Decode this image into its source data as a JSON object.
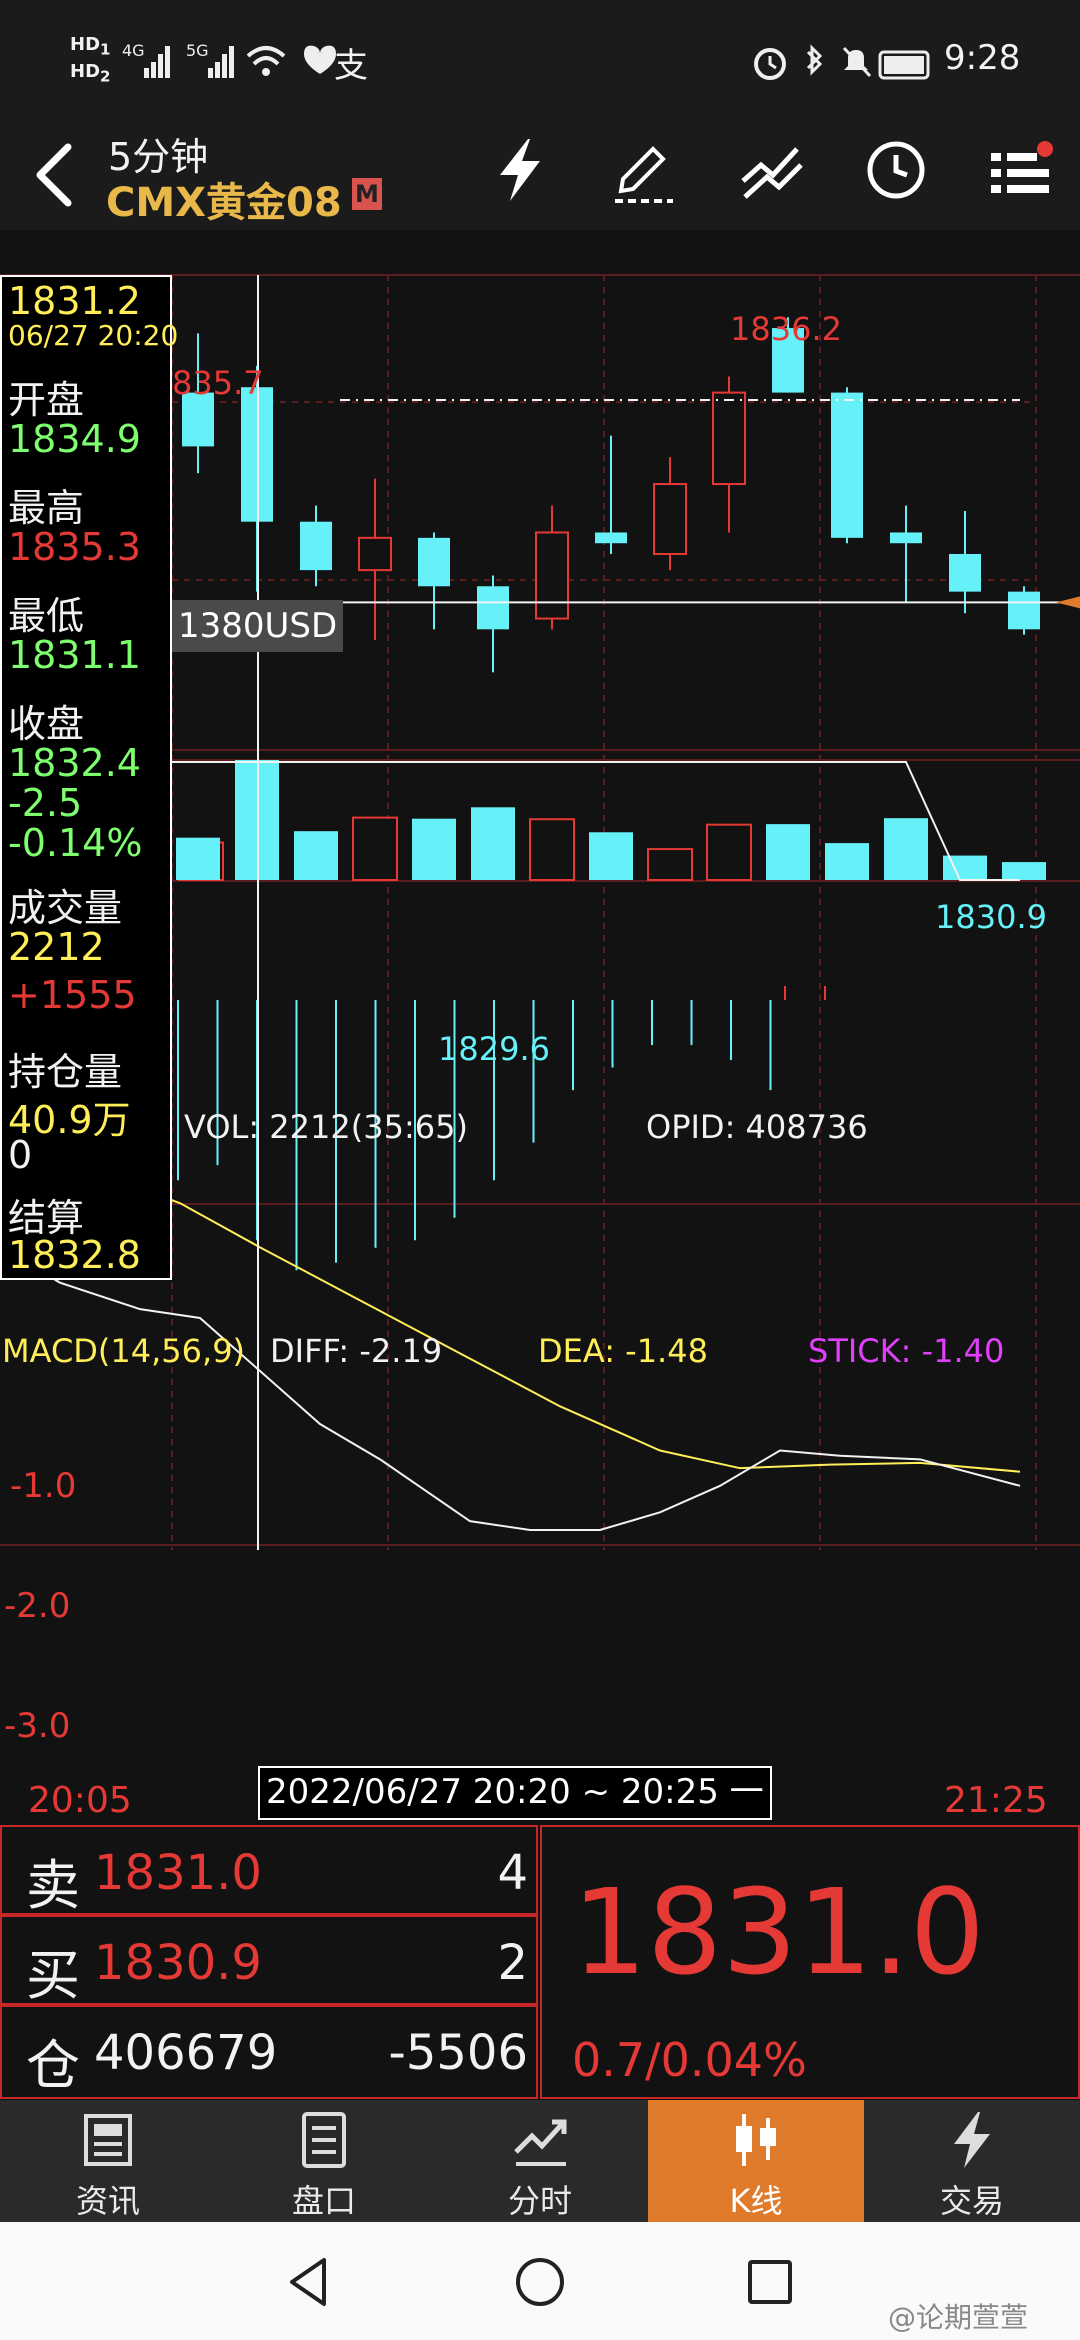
{
  "status_bar": {
    "left_text": "HD HD 4G 5G",
    "right_time": "9:28",
    "icons_right": [
      "alarm-icon",
      "bluetooth-icon",
      "mute-icon",
      "battery-icon"
    ]
  },
  "header": {
    "period": "5分钟",
    "symbol": "CMX黄金08",
    "badge": "M",
    "icons": [
      "lightning-icon",
      "draw-icon",
      "indicator-icon",
      "clock-icon",
      "menu-icon"
    ]
  },
  "info_panel": {
    "price": "1831.2",
    "datetime": "06/27 20:20",
    "open_label": "开盘",
    "open": "1834.9",
    "high_label": "最高",
    "high": "1835.3",
    "low_label": "最低",
    "low": "1831.1",
    "close_label": "收盘",
    "close": "1832.4",
    "change": "-2.5",
    "change_pct": "-0.14%",
    "volume_label": "成交量",
    "volume": "2212",
    "volume_change": "+1555",
    "oi_label": "持仓量",
    "oi": "40.9万",
    "oi_change": "0",
    "settle_label": "结算",
    "settle": "1832.8"
  },
  "chart_data": {
    "type": "candlestick",
    "title": "",
    "price_axis_label": "1380USD",
    "labels": {
      "max_high": "1836.2",
      "min_low": "1829.6",
      "last": "1830.9",
      "left_high_partial": "835.7"
    },
    "candles": [
      {
        "open": 1834.8,
        "close": 1833.8,
        "high": 1835.9,
        "low": 1833.3
      },
      {
        "open": 1834.9,
        "close": 1832.4,
        "high": 1835.3,
        "low": 1831.1
      },
      {
        "open": 1832.4,
        "close": 1831.5,
        "high": 1832.7,
        "low": 1831.2
      },
      {
        "open": 1831.5,
        "close": 1832.1,
        "high": 1833.2,
        "low": 1830.2
      },
      {
        "open": 1832.1,
        "close": 1831.2,
        "high": 1832.2,
        "low": 1830.4
      },
      {
        "open": 1831.2,
        "close": 1830.4,
        "high": 1831.4,
        "low": 1829.6
      },
      {
        "open": 1830.6,
        "close": 1832.2,
        "high": 1832.7,
        "low": 1830.4
      },
      {
        "open": 1832.2,
        "close": 1832.0,
        "high": 1834.0,
        "low": 1831.8
      },
      {
        "open": 1831.8,
        "close": 1833.1,
        "high": 1833.6,
        "low": 1831.5
      },
      {
        "open": 1833.1,
        "close": 1834.8,
        "high": 1835.1,
        "low": 1832.2
      },
      {
        "open": 1836.0,
        "close": 1834.8,
        "high": 1836.2,
        "low": 1834.8
      },
      {
        "open": 1834.8,
        "close": 1832.1,
        "high": 1834.9,
        "low": 1832.0
      },
      {
        "open": 1832.2,
        "close": 1832.0,
        "high": 1832.7,
        "low": 1830.9
      },
      {
        "open": 1831.8,
        "close": 1831.1,
        "high": 1832.6,
        "low": 1830.7
      },
      {
        "open": 1831.1,
        "close": 1830.4,
        "high": 1831.2,
        "low": 1830.3
      }
    ],
    "price_range": [
      1828.9,
      1836.8
    ],
    "volume": {
      "label": "VOL: 2212(35:65)",
      "opid_label": "OPID: 408736",
      "bars": [
        {
          "v": 780,
          "up": false
        },
        {
          "v": 2212,
          "up": false
        },
        {
          "v": 900,
          "up": false
        },
        {
          "v": 1150,
          "up": true
        },
        {
          "v": 1130,
          "up": false
        },
        {
          "v": 1340,
          "up": false
        },
        {
          "v": 1120,
          "up": true
        },
        {
          "v": 880,
          "up": false
        },
        {
          "v": 570,
          "up": true
        },
        {
          "v": 1020,
          "up": true
        },
        {
          "v": 1030,
          "up": false
        },
        {
          "v": 680,
          "up": false
        },
        {
          "v": 1140,
          "up": false
        },
        {
          "v": 450,
          "up": false
        },
        {
          "v": 330,
          "up": false
        }
      ],
      "lead_bars": [
        560,
        560,
        560,
        690
      ]
    },
    "macd": {
      "label": "MACD(14,56,9)",
      "diff_label": "DIFF: -2.19",
      "dea_label": "DEA: -1.48",
      "stick_label": "STICK: -1.40",
      "y_ticks": [
        "-1.0",
        "-2.0",
        "-3.0"
      ],
      "ylim": [
        -3.2,
        -0.2
      ]
    },
    "time_axis": {
      "start": "20:05",
      "end": "21:25",
      "cursor": "2022/06/27 20:20 ~ 20:25 一"
    }
  },
  "quote": {
    "sell_label": "卖",
    "sell_price": "1831.0",
    "sell_qty": "4",
    "buy_label": "买",
    "buy_price": "1830.9",
    "buy_qty": "2",
    "oi_label": "仓",
    "oi_value": "406679",
    "oi_change": "-5506",
    "last_price": "1831.0",
    "change": "0.7/0.04%"
  },
  "bottom_nav": [
    {
      "label": "资讯",
      "icon": "news-icon",
      "active": false
    },
    {
      "label": "盘口",
      "icon": "orderbook-icon",
      "active": false
    },
    {
      "label": "分时",
      "icon": "timeline-icon",
      "active": false
    },
    {
      "label": "K线",
      "icon": "kline-icon",
      "active": true
    },
    {
      "label": "交易",
      "icon": "trade-icon",
      "active": false
    }
  ],
  "watermark": "@论期萱萱",
  "colors": {
    "up": "#e53935",
    "down": "#66f0f8",
    "accent": "#e07b2b",
    "gold": "#e8b84a",
    "green": "#7dff6e",
    "yellow": "#ffee58",
    "magenta": "#e040fb"
  }
}
